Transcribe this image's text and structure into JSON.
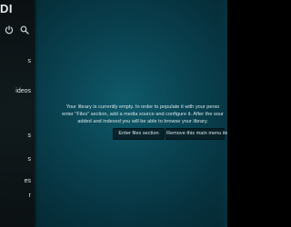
{
  "app": {
    "logo_text": "DI"
  },
  "sidebar": {
    "items": [
      {
        "label": "s"
      },
      {
        "label": "ideos"
      },
      {
        "label": "s"
      },
      {
        "label": "s"
      },
      {
        "label": "es"
      },
      {
        "label": "r"
      }
    ],
    "icons": [
      "power-icon",
      "search-icon"
    ]
  },
  "main": {
    "message_lines": [
      "Your library is currently empty. In order to populate it with your perso",
      "enter \"Files\" section, add a media source and configure it. After the sour",
      "added and indexed you will be able to browse your library."
    ],
    "buttons": {
      "enter_files": "Enter files section",
      "remove_item": "Remove this main menu item"
    }
  },
  "colors": {
    "background": "#0a4453",
    "sidebar": "#0e1619",
    "text": "#d6e4e8"
  }
}
